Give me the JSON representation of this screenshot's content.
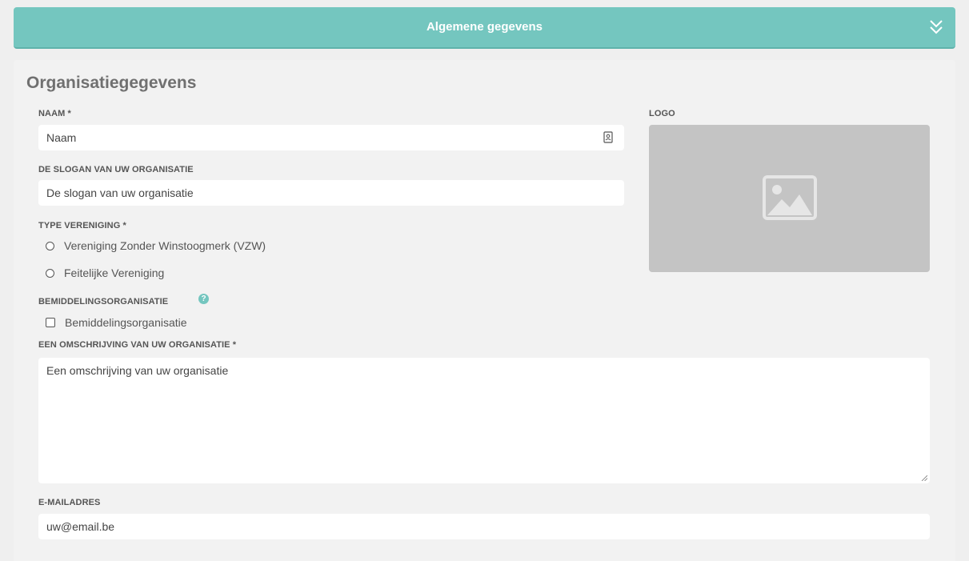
{
  "accordion": {
    "title": "Algemene gegevens",
    "expand_icon": "double-chevron-down-icon"
  },
  "section": {
    "title": "Organisatiegegevens"
  },
  "naam": {
    "label": "NAAM *",
    "placeholder": "Naam",
    "icon": "contact-card-icon"
  },
  "slogan": {
    "label": "DE SLOGAN VAN UW ORGANISATIE",
    "placeholder": "De slogan van uw organisatie"
  },
  "type_vereniging": {
    "label": "TYPE VERENIGING *",
    "options": [
      "Vereniging Zonder Winstoogmerk (VZW)",
      "Feitelijke Vereniging"
    ]
  },
  "bemiddeling": {
    "label": "BEMIDDELINGSORGANISATIE",
    "help_icon": "question-mark-icon",
    "checkbox_label": "Bemiddelingsorganisatie"
  },
  "omschrijving": {
    "label": "EEN OMSCHRIJVING VAN UW ORGANISATIE *",
    "placeholder": "Een omschrijving van uw organisatie"
  },
  "email": {
    "label": "E-MAILADRES",
    "placeholder": "uw@email.be"
  },
  "logo": {
    "label": "LOGO",
    "icon": "image-placeholder-icon"
  },
  "colors": {
    "accent": "#74c6bf",
    "panel_bg": "#f2f2f2",
    "logo_bg": "#c4c4c4"
  }
}
